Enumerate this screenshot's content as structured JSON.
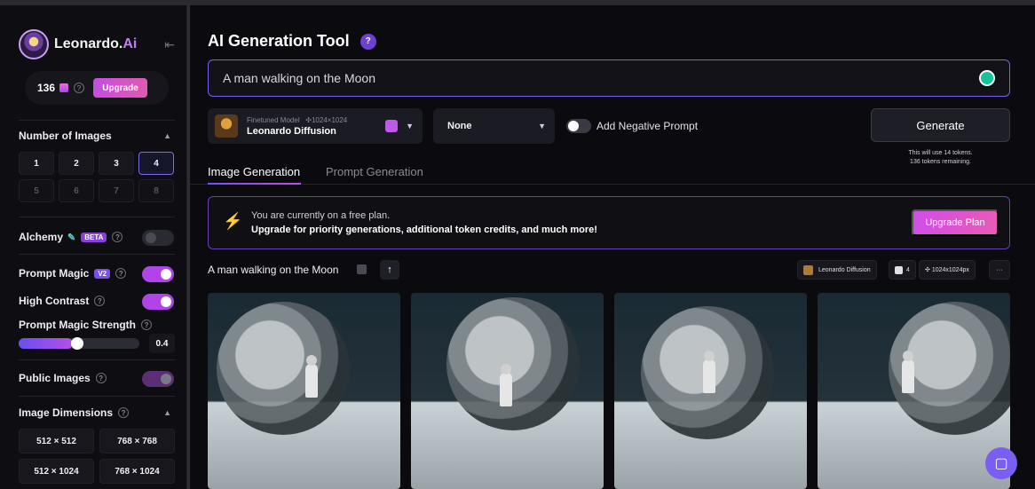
{
  "app": {
    "logo_text": "Leonardo.",
    "logo_accent": "Ai",
    "tokens": "136"
  },
  "sidebar": {
    "upgrade_label": "Upgrade",
    "number_of_images": {
      "title": "Number of Images",
      "options": [
        "1",
        "2",
        "3",
        "4",
        "5",
        "6",
        "7",
        "8"
      ],
      "selected": "4"
    },
    "alchemy": {
      "label": "Alchemy",
      "badge": "BETA",
      "enabled": false
    },
    "prompt_magic": {
      "label": "Prompt Magic",
      "badge": "V2",
      "enabled": true
    },
    "high_contrast": {
      "label": "High Contrast",
      "enabled": true
    },
    "prompt_magic_strength": {
      "label": "Prompt Magic Strength",
      "value": "0.4",
      "fraction": 0.4
    },
    "public_images": {
      "label": "Public Images",
      "enabled": true
    },
    "image_dimensions": {
      "title": "Image Dimensions",
      "options": [
        "512 × 512",
        "768 × 768",
        "512 × 1024",
        "768 × 1024"
      ]
    }
  },
  "main": {
    "title": "AI Generation Tool",
    "prompt_value": "A man walking on the Moon",
    "model": {
      "small_label": "Finetuned Model",
      "resolution": "1024×1024",
      "name": "Leonardo Diffusion"
    },
    "style_select": "None",
    "negative_prompt_label": "Add Negative Prompt",
    "generate_label": "Generate",
    "token_note_1": "This will use 14 tokens.",
    "token_note_2": "136 tokens remaining.",
    "tabs": [
      {
        "label": "Image Generation",
        "active": true
      },
      {
        "label": "Prompt Generation",
        "active": false
      }
    ],
    "banner": {
      "line1": "You are currently on a free plan.",
      "line2": "Upgrade for priority generations, additional token credits, and much more!",
      "button": "Upgrade Plan"
    },
    "generation": {
      "prompt": "A man walking on the Moon",
      "model_chip": "Leonardo Diffusion",
      "count_chip": "4",
      "size_chip": "1024x1024px",
      "more": "···"
    }
  },
  "colors": {
    "accent": "#7a5ef2",
    "pink": "#e05ab0",
    "background": "#0b0b0f"
  }
}
